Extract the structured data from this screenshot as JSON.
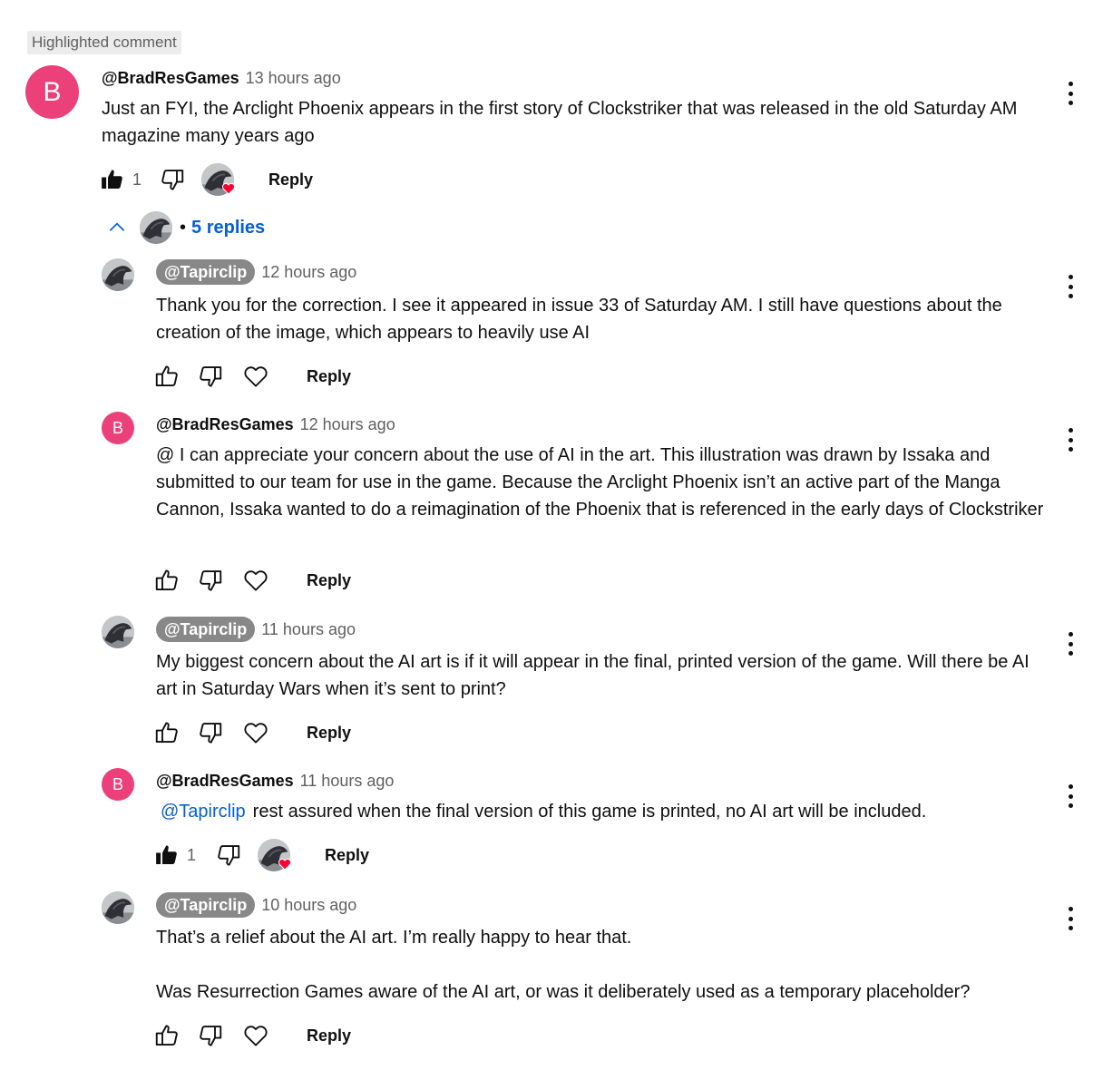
{
  "highlight_badge": "Highlighted comment",
  "main_comment": {
    "avatar_letter": "B",
    "author": "@BradResGames",
    "time": "13 hours ago",
    "text": "Just an FYI, the Arclight Phoenix appears in the first story of Clockstriker that was released in the old Saturday AM magazine many years ago",
    "like_count": "1",
    "reply_label": "Reply"
  },
  "replies_toggle": {
    "label": "5 replies",
    "separator": "•"
  },
  "replies": [
    {
      "author": "@Tapirclip",
      "time": "12 hours ago",
      "text": "Thank you for the correction. I see it appeared in issue 33 of Saturday AM. I still have questions about the creation of the image, which appears to heavily use AI",
      "reply_label": "Reply"
    },
    {
      "avatar_letter": "B",
      "author": "@BradResGames",
      "time": "12 hours ago",
      "text": "@ I can appreciate your concern about the use of AI in the art. This illustration was drawn by Issaka and submitted to our team for use in the game. Because the Arclight Phoenix isn’t an active part of the Manga Cannon, Issaka wanted to do a reimagination of the Phoenix that is referenced in the early days of Clockstriker",
      "reply_label": "Reply"
    },
    {
      "author": "@Tapirclip",
      "time": "11 hours ago",
      "text": "My biggest concern about the AI art is if it will appear in the final, printed version of the game. Will there be AI art in Saturday Wars when it’s sent to print?",
      "reply_label": "Reply"
    },
    {
      "avatar_letter": "B",
      "author": "@BradResGames",
      "time": "11 hours ago",
      "mention": "@Tapirclip",
      "text": "rest assured when the final version of this game is printed, no AI art will be included.",
      "like_count": "1",
      "reply_label": "Reply"
    },
    {
      "author": "@Tapirclip",
      "time": "10 hours ago",
      "text_p1": "That’s a relief about the AI art. I’m really happy to hear that.",
      "text_p2": "Was Resurrection Games aware of the AI art, or was it deliberately used as a temporary placeholder?",
      "reply_label": "Reply"
    }
  ],
  "colors": {
    "avatar_pink": "#ec407a",
    "link_blue": "#065fd4",
    "chip_gray": "#888888",
    "heart_red": "#ff0033"
  },
  "icons": [
    "thumb-up-icon",
    "thumb-up-filled-icon",
    "thumb-down-icon",
    "heart-icon",
    "chevron-up-icon",
    "kebab-menu-icon"
  ]
}
